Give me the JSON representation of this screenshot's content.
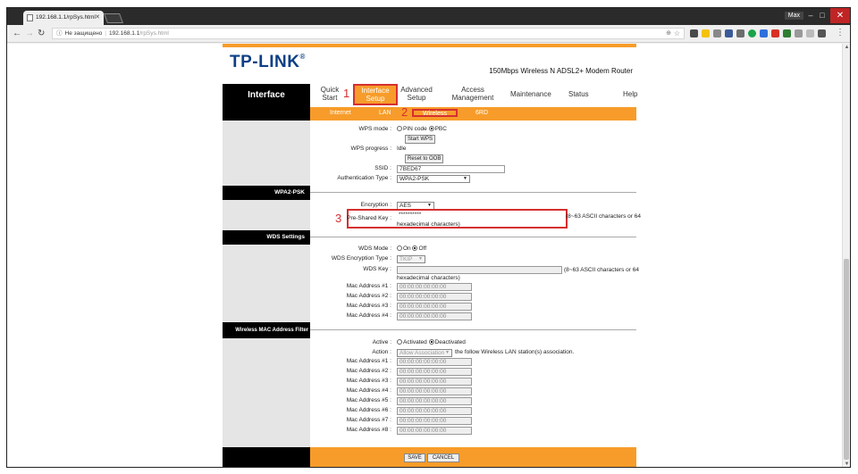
{
  "browser": {
    "tab_title": "192.168.1.1/rpSys.html",
    "user": "Max",
    "security_text": "Не защищено",
    "url_host": "192.168.1.1",
    "url_path": "/rpSys.html"
  },
  "router": {
    "logo": "TP-LINK",
    "model": "150Mbps Wireless N ADSL2+ Modem Router"
  },
  "nav": {
    "side_title": "Interface",
    "quick_start": "Quick Start",
    "interface_setup": "Interface Setup",
    "advanced_setup": "Advanced Setup",
    "access_management": "Access Management",
    "maintenance": "Maintenance",
    "status": "Status",
    "help": "Help"
  },
  "subnav": {
    "internet": "Internet",
    "lan": "LAN",
    "wireless": "Wireless",
    "sixrd": "6RD"
  },
  "callouts": {
    "one": "1",
    "two": "2",
    "three": "3"
  },
  "wps": {
    "mode_label": "WPS mode :",
    "pin": "PIN code",
    "pbc": "PBC",
    "start_btn": "Start WPS",
    "progress_label": "WPS progress :",
    "progress_value": "Idle",
    "reset_btn": "Reset to OOB",
    "ssid_label": "SSID :",
    "ssid_value": "7BED67",
    "auth_label": "Authentication Type :",
    "auth_value": "WPA2-PSK"
  },
  "wpa2": {
    "section": "WPA2-PSK",
    "enc_label": "Encryption :",
    "enc_value": "AES",
    "psk_label": "Pre-Shared Key :",
    "psk_value": "**********",
    "hint_a": "(8~63 ASCII characters or 64",
    "hint_b": "hexadecimal characters)"
  },
  "wds": {
    "section": "WDS Settings",
    "mode_label": "WDS Mode :",
    "on": "On",
    "off": "Off",
    "enc_label": "WDS Encryption Type :",
    "enc_value": "TKIP",
    "key_label": "WDS Key :",
    "hint_a": "(8~63 ASCII characters or 64",
    "hint_b": "hexadecimal characters)",
    "macs": [
      {
        "label": "Mac Address #1 :",
        "value": "00:00:00:00:00:00"
      },
      {
        "label": "Mac Address #2 :",
        "value": "00:00:00:00:00:00"
      },
      {
        "label": "Mac Address #3 :",
        "value": "00:00:00:00:00:00"
      },
      {
        "label": "Mac Address #4 :",
        "value": "00:00:00:00:00:00"
      }
    ]
  },
  "macfilter": {
    "section": "Wireless MAC Address Filter",
    "active_label": "Active :",
    "activated": "Activated",
    "deactivated": "Deactivated",
    "action_label": "Action :",
    "action_value": "Allow Association",
    "action_suffix": "the follow Wireless LAN station(s) association.",
    "macs": [
      {
        "label": "Mac Address #1 :",
        "value": "00:00:00:00:00:00"
      },
      {
        "label": "Mac Address #2 :",
        "value": "00:00:00:00:00:00"
      },
      {
        "label": "Mac Address #3 :",
        "value": "00:00:00:00:00:00"
      },
      {
        "label": "Mac Address #4 :",
        "value": "00:00:00:00:00:00"
      },
      {
        "label": "Mac Address #5 :",
        "value": "00:00:00:00:00:00"
      },
      {
        "label": "Mac Address #6 :",
        "value": "00:00:00:00:00:00"
      },
      {
        "label": "Mac Address #7 :",
        "value": "00:00:00:00:00:00"
      },
      {
        "label": "Mac Address #8 :",
        "value": "00:00:00:00:00:00"
      }
    ]
  },
  "footer": {
    "save": "SAVE",
    "cancel": "CANCEL"
  },
  "colors": {
    "orange": "#f79c2a",
    "highlight": "#d62f2f",
    "brand": "#0d3f86"
  }
}
